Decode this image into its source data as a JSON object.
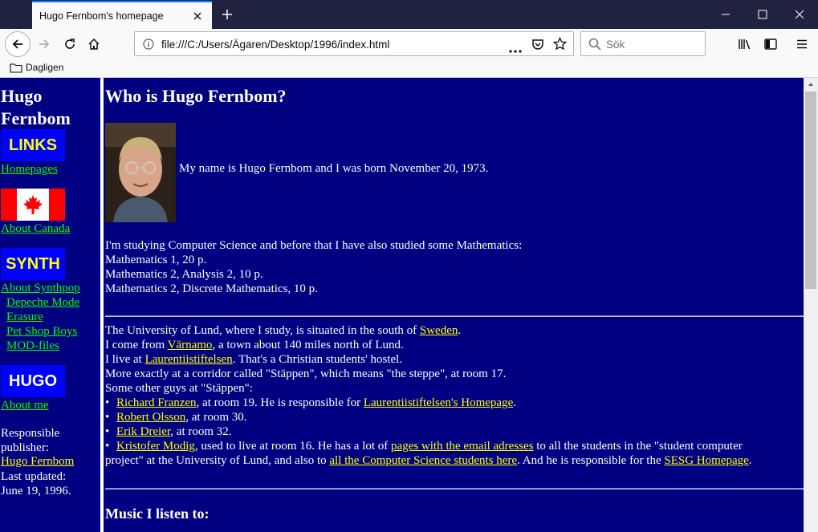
{
  "browser": {
    "tab_title": "Hugo Fernbom's homepage",
    "url": "file:///C:/Users/Ägaren/Desktop/1996/index.html",
    "search_placeholder": "Sök",
    "bookmarks": [
      "Dagligen"
    ]
  },
  "left": {
    "name_line1": "Hugo",
    "name_line2": "Fernbom",
    "badge_links": "LINKS",
    "link_homepages": "Homepages",
    "link_canada": "About Canada",
    "badge_synth": "SYNTH",
    "link_synthpop": "About Synthpop",
    "synth_links": [
      "Depeche Mode",
      "Erasure",
      "Pet Shop Boys",
      "MOD-files"
    ],
    "badge_hugo": "HUGO",
    "link_about_me": "About me",
    "publisher_label": "Responsible",
    "publisher_label2": "publisher:",
    "publisher_name": "Hugo Fernbom",
    "updated_label": "Last updated:",
    "updated_date": "June 19, 1996."
  },
  "main": {
    "heading": "Who is Hugo Fernbom?",
    "intro": "My name is Hugo Fernbom and I was born November 20, 1973.",
    "studies": [
      "I'm studying Computer Science and before that I have also studied some Mathematics:",
      "Mathematics 1, 20 p.",
      "Mathematics 2, Analysis 2, 10 p.",
      "Mathematics 2, Discrete Mathematics, 10 p."
    ],
    "p2": {
      "l1_pre": "The University of Lund, where I study, is situated in the south of ",
      "l1_link": "Sweden",
      "l1_post": ".",
      "l2_pre": "I come from ",
      "l2_link": "Värnamo",
      "l2_post": ", a town about 140 miles north of Lund.",
      "l3_pre": "I live at ",
      "l3_link": "Laurentiistiftelsen",
      "l3_post": ". That's a Christian students' hostel.",
      "l4": "More exactly at a corridor called \"Stäppen\", which means \"the steppe\", at room 17.",
      "l5": "Some other guys at \"Stäppen\":"
    },
    "guys": {
      "g1_link": "Richard Franzen",
      "g1_mid": ", at room 19. He is responsible for ",
      "g1_link2": "Laurentiistiftelsen's Homepage",
      "g1_post": ".",
      "g2_link": "Robert Olsson",
      "g2_post": ", at room 30.",
      "g3_link": "Erik Dreier",
      "g3_post": ", at room 32.",
      "g4_link": "Kristofer Modig",
      "g4_mid": ", used to live at room 16. He has a lot of ",
      "g4_link2": "pages with the email adresses",
      "g4_post": " to all the students in the \"student computer",
      "g4_l2_pre": "project\" at the University of Lund, and also to ",
      "g4_link3": "all the Computer Science students here",
      "g4_l2_mid": ". And he is responsible for the ",
      "g4_link4": "SESG Homepage",
      "g4_l2_post": "."
    },
    "music_heading": "Music I listen to:"
  },
  "colors": {
    "page_bg": "#000080",
    "link": "#ffff00",
    "nav_link": "#00ff00",
    "badge_bg": "#0000ff"
  }
}
